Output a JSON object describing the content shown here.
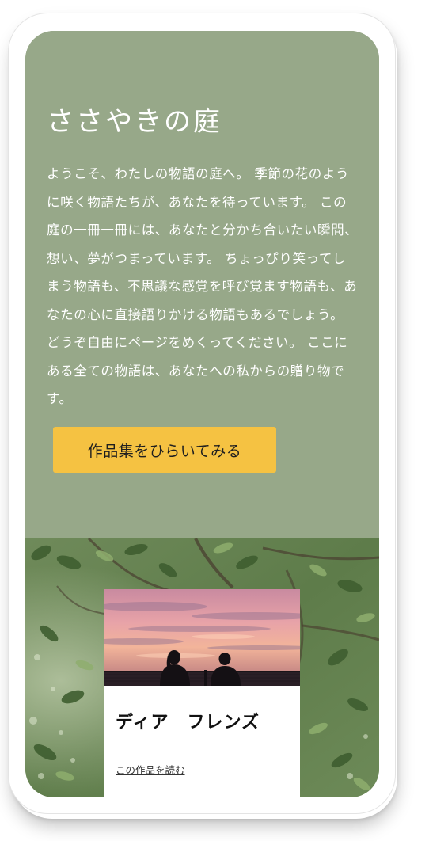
{
  "hero": {
    "title": "ささやきの庭",
    "body": "ようこそ、わたしの物語の庭へ。 季節の花のように咲く物語たちが、あなたを待っています。 この庭の一冊一冊には、あなたと分かち合いたい瞬間、想い、夢がつまっています。 ちょっぴり笑ってしまう物語も、不思議な感覚を呼び覚ます物語も、あなたの心に直接語りかける物語もあるでしょう。 どうぞ自由にページをめくってください。 ここにある全ての物語は、あなたへの私からの贈り物です。",
    "cta_label": "作品集をひらいてみる"
  },
  "featured_work": {
    "title": "ディア　フレンズ",
    "read_link": "この作品を読む"
  },
  "colors": {
    "hero_background": "#97a889",
    "cta_background": "#f5c242",
    "card_background": "#ffffff"
  }
}
